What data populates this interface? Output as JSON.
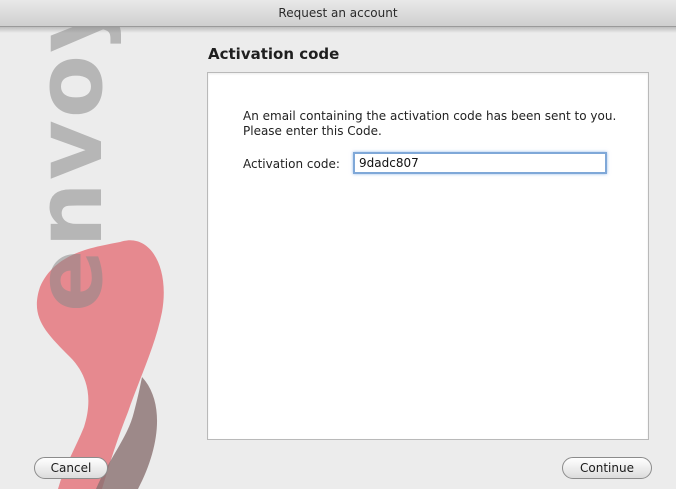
{
  "window": {
    "title": "Request an account"
  },
  "logo": {
    "text": "envoy",
    "brand_color": "#e5787f",
    "secondary_color": "#8a7070"
  },
  "page": {
    "title": "Activation code",
    "instructions": "An email containing the activation code has been sent to you. Please enter this Code.",
    "code_label": "Activation code:",
    "code_value": "9dadc807"
  },
  "buttons": {
    "cancel": "Cancel",
    "continue": "Continue"
  },
  "colors": {
    "focus_ring": "#7fa8d8"
  }
}
